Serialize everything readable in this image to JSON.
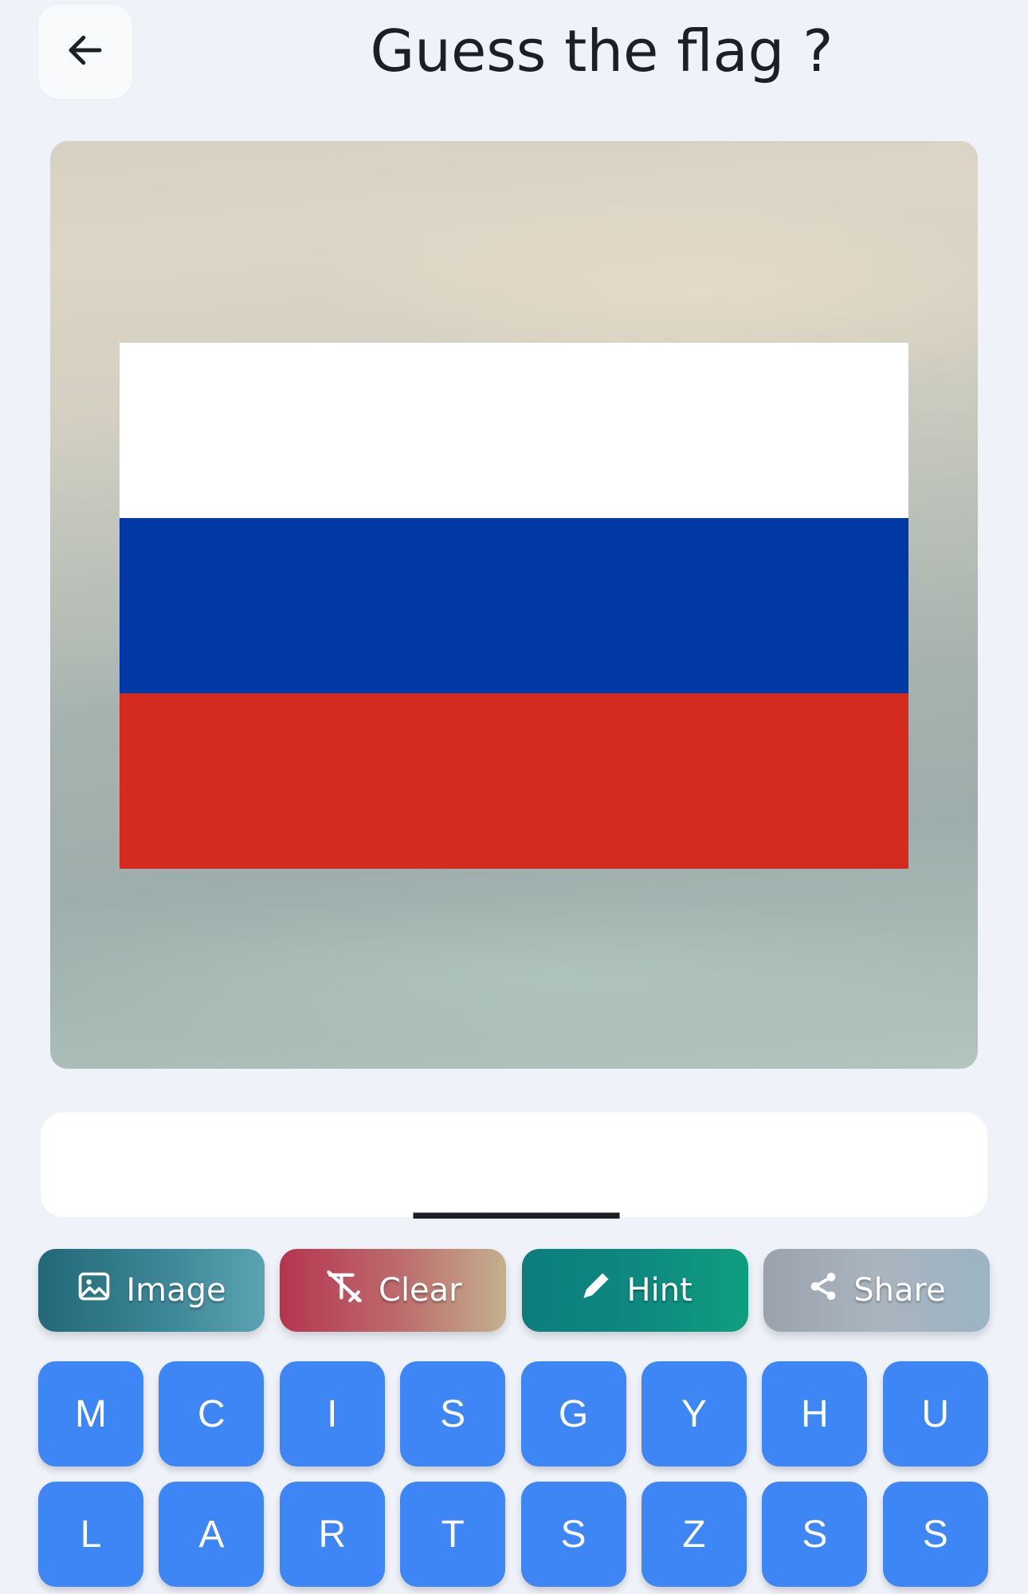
{
  "header": {
    "title": "Guess the flag ?"
  },
  "flag": {
    "stripes": [
      "#ffffff",
      "#0039a6",
      "#d52b1e"
    ]
  },
  "answer": {
    "slots": "______"
  },
  "actions": {
    "image_label": "Image",
    "clear_label": "Clear",
    "hint_label": "Hint",
    "share_label": "Share"
  },
  "keyboard": {
    "keys": [
      "M",
      "C",
      "I",
      "S",
      "G",
      "Y",
      "H",
      "U",
      "L",
      "A",
      "R",
      "T",
      "S",
      "Z",
      "S",
      "S"
    ]
  },
  "colors": {
    "background": "#eff3f9",
    "key": "#3e86f5",
    "title_text": "#1c1f24"
  }
}
